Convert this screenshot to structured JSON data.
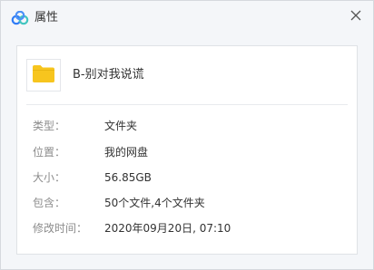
{
  "window": {
    "title": "属性"
  },
  "file": {
    "name": "B-别对我说谎",
    "icon": "folder-icon"
  },
  "properties": [
    {
      "label": "类型：",
      "value": "文件夹"
    },
    {
      "label": "位置：",
      "value": "我的网盘"
    },
    {
      "label": "大小：",
      "value": "56.85GB"
    },
    {
      "label": "包含：",
      "value": "50个文件,4个文件夹"
    },
    {
      "label": "修改时间：",
      "value": "2020年09月20日, 07:10"
    }
  ],
  "colors": {
    "folder": "#f7c51e",
    "logo_blue": "#2f7cf6",
    "logo_teal": "#42c5c0"
  }
}
